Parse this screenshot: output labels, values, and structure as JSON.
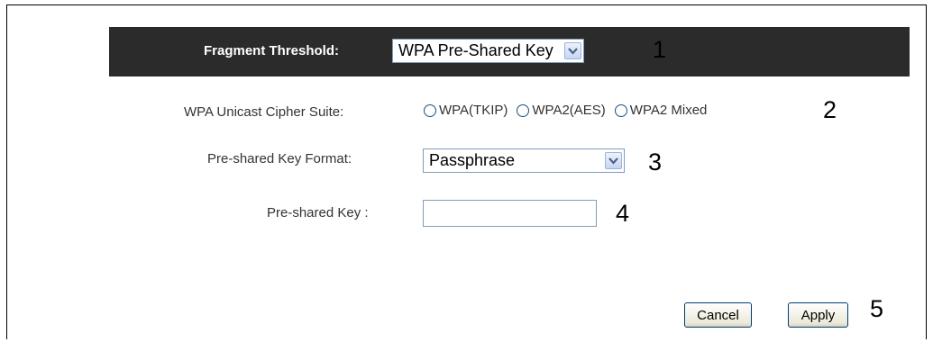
{
  "header": {
    "label": "Fragment Threshold:",
    "select_value": "WPA Pre-Shared Key",
    "number": "1"
  },
  "cipher": {
    "label": "WPA Unicast Cipher Suite:",
    "options": [
      "WPA(TKIP)",
      "WPA2(AES)",
      "WPA2 Mixed"
    ],
    "number": "2"
  },
  "key_format": {
    "label": "Pre-shared Key Format:",
    "select_value": "Passphrase",
    "number": "3"
  },
  "key": {
    "label": "Pre-shared Key :",
    "value": "",
    "number": "4"
  },
  "buttons": {
    "cancel": "Cancel",
    "apply": "Apply",
    "number": "5"
  },
  "icons": {
    "dropdown": "chevron-down-icon",
    "radio": "radio-unchecked-icon"
  },
  "colors": {
    "header_bg": "#2b2b2b",
    "header_text": "#ffffff",
    "label_text": "#333333",
    "border_blue": "#7f9db9"
  }
}
